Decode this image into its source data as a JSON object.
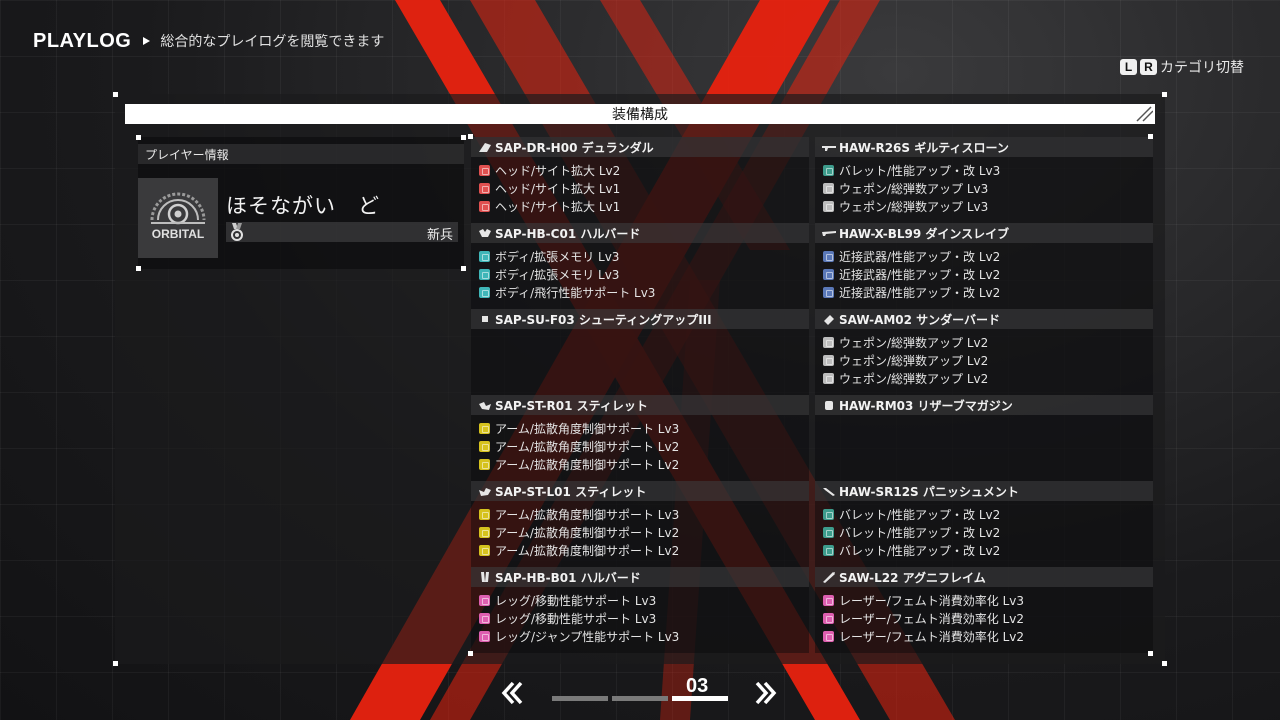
{
  "header": {
    "title": "PLAYLOG",
    "subtitle": "総合的なプレイログを閲覧できます"
  },
  "category_switch": {
    "key_l": "L",
    "key_r": "R",
    "label": "カテゴリ切替"
  },
  "panel": {
    "title": "装備構成"
  },
  "player": {
    "header": "プレイヤー情報",
    "emblem_text": "ORBITAL",
    "name": "ほそながい　ど",
    "rank": "新兵"
  },
  "colors": {
    "accent_red": "#e8220f",
    "panel_white": "#ffffff",
    "chip_red": "#e05050",
    "chip_cyan": "#3fb6b8",
    "chip_yellow": "#d6c21e",
    "chip_pink": "#de5fb0",
    "chip_teal": "#3d9c8c",
    "chip_silver": "#bdbdbd",
    "chip_blue": "#5a78b8"
  },
  "parts_left": [
    {
      "name": "SAP-DR-H00 デュランダル",
      "icon": "head-part-icon",
      "chips": [
        {
          "label": "ヘッド/サイト拡大 Lv2",
          "color": "#e05050"
        },
        {
          "label": "ヘッド/サイト拡大 Lv1",
          "color": "#e05050"
        },
        {
          "label": "ヘッド/サイト拡大 Lv1",
          "color": "#e05050"
        }
      ]
    },
    {
      "name": "SAP-HB-C01 ハルバード",
      "icon": "body-part-icon",
      "chips": [
        {
          "label": "ボディ/拡張メモリ Lv3",
          "color": "#3fb6b8"
        },
        {
          "label": "ボディ/拡張メモリ Lv3",
          "color": "#3fb6b8"
        },
        {
          "label": "ボディ/飛行性能サポート Lv3",
          "color": "#3fb6b8"
        }
      ]
    },
    {
      "name": "SAP-SU-F03 シューティングアップIII",
      "icon": "support-part-icon",
      "chips": []
    },
    {
      "name": "SAP-ST-R01 スティレット",
      "icon": "right-arm-part-icon",
      "chips": [
        {
          "label": "アーム/拡散角度制御サポート Lv3",
          "color": "#d6c21e"
        },
        {
          "label": "アーム/拡散角度制御サポート Lv2",
          "color": "#d6c21e"
        },
        {
          "label": "アーム/拡散角度制御サポート Lv2",
          "color": "#d6c21e"
        }
      ]
    },
    {
      "name": "SAP-ST-L01 スティレット",
      "icon": "left-arm-part-icon",
      "chips": [
        {
          "label": "アーム/拡散角度制御サポート Lv3",
          "color": "#d6c21e"
        },
        {
          "label": "アーム/拡散角度制御サポート Lv2",
          "color": "#d6c21e"
        },
        {
          "label": "アーム/拡散角度制御サポート Lv2",
          "color": "#d6c21e"
        }
      ]
    },
    {
      "name": "SAP-HB-B01 ハルバード",
      "icon": "leg-part-icon",
      "chips": [
        {
          "label": "レッグ/移動性能サポート Lv3",
          "color": "#de5fb0"
        },
        {
          "label": "レッグ/移動性能サポート Lv3",
          "color": "#de5fb0"
        },
        {
          "label": "レッグ/ジャンプ性能サポート Lv3",
          "color": "#de5fb0"
        }
      ]
    }
  ],
  "parts_right": [
    {
      "name": "HAW-R26S ギルティスローン",
      "icon": "rifle-weapon-icon",
      "chips": [
        {
          "label": "バレット/性能アップ・改 Lv3",
          "color": "#3d9c8c"
        },
        {
          "label": "ウェポン/総弾数アップ Lv3",
          "color": "#bdbdbd"
        },
        {
          "label": "ウェポン/総弾数アップ Lv3",
          "color": "#bdbdbd"
        }
      ]
    },
    {
      "name": "HAW-X-BL99 ダインスレイブ",
      "icon": "blade-weapon-icon",
      "chips": [
        {
          "label": "近接武器/性能アップ・改 Lv2",
          "color": "#5a78b8"
        },
        {
          "label": "近接武器/性能アップ・改 Lv2",
          "color": "#5a78b8"
        },
        {
          "label": "近接武器/性能アップ・改 Lv2",
          "color": "#5a78b8"
        }
      ]
    },
    {
      "name": "SAW-AM02 サンダーバード",
      "icon": "ammo-weapon-icon",
      "chips": [
        {
          "label": "ウェポン/総弾数アップ Lv2",
          "color": "#bdbdbd"
        },
        {
          "label": "ウェポン/総弾数アップ Lv2",
          "color": "#bdbdbd"
        },
        {
          "label": "ウェポン/総弾数アップ Lv2",
          "color": "#bdbdbd"
        }
      ]
    },
    {
      "name": "HAW-RM03 リザーブマガジン",
      "icon": "magazine-weapon-icon",
      "chips": []
    },
    {
      "name": "HAW-SR12S パニッシュメント",
      "icon": "sniper-weapon-icon",
      "chips": [
        {
          "label": "バレット/性能アップ・改 Lv2",
          "color": "#3d9c8c"
        },
        {
          "label": "バレット/性能アップ・改 Lv2",
          "color": "#3d9c8c"
        },
        {
          "label": "バレット/性能アップ・改 Lv2",
          "color": "#3d9c8c"
        }
      ]
    },
    {
      "name": "SAW-L22 アグニフレイム",
      "icon": "laser-weapon-icon",
      "chips": [
        {
          "label": "レーザー/フェムト消費効率化 Lv3",
          "color": "#de5fb0"
        },
        {
          "label": "レーザー/フェムト消費効率化 Lv2",
          "color": "#de5fb0"
        },
        {
          "label": "レーザー/フェムト消費効率化 Lv2",
          "color": "#de5fb0"
        }
      ]
    }
  ],
  "pager": {
    "page": "03",
    "total_pages": 3,
    "current_index": 3
  }
}
